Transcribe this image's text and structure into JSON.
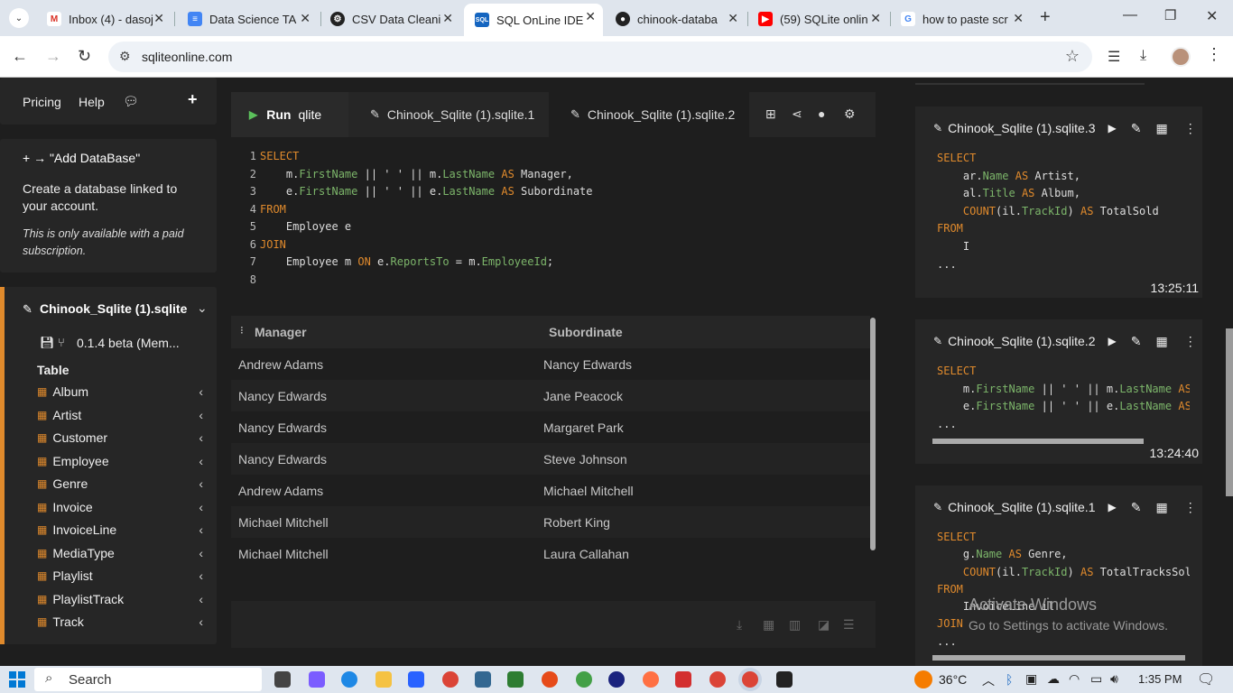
{
  "browser": {
    "tabs": [
      {
        "title": "Inbox (4) - dasoj",
        "icon": "gmail-icon",
        "color": "#d93025"
      },
      {
        "title": "Data Science TA",
        "icon": "docs-icon",
        "color": "#4285f4"
      },
      {
        "title": "CSV Data Cleani",
        "icon": "chatgpt-icon",
        "color": "#222222"
      },
      {
        "title": "SQL OnLine IDE",
        "icon": "sqlonline-icon",
        "color": "#1565c0",
        "active": true
      },
      {
        "title": "chinook-databa",
        "icon": "github-icon",
        "color": "#222222"
      },
      {
        "title": "(59) SQLite onlin",
        "icon": "youtube-icon",
        "color": "#ff0000"
      },
      {
        "title": "how to paste scr",
        "icon": "google-icon",
        "color": "#4285f4"
      }
    ],
    "url": "sqliteonline.com"
  },
  "sidebar": {
    "nav": {
      "pricing": "Pricing",
      "help": "Help"
    },
    "add_db": {
      "title": "+ → \"Add DataBase\"",
      "desc": "Create a database linked to your account.",
      "note": "This is only available with a paid subscription."
    },
    "db": {
      "name": "Chinook_Sqlite (1).sqlite",
      "version": "0.1.4 beta (Mem...",
      "table_header": "Table",
      "tables": [
        "Album",
        "Artist",
        "Customer",
        "Employee",
        "Genre",
        "Invoice",
        "InvoiceLine",
        "MediaType",
        "Playlist",
        "PlaylistTrack",
        "Track"
      ]
    }
  },
  "editor_tabs": {
    "run": "Run",
    "engine": "qlite",
    "tab1": "Chinook_Sqlite (1).sqlite.1",
    "tab2": "Chinook_Sqlite (1).sqlite.2"
  },
  "editor": {
    "line_numbers": [
      "1",
      "2",
      "3",
      "4",
      "5",
      "6",
      "7",
      "8"
    ]
  },
  "results": {
    "columns": [
      "Manager",
      "Subordinate"
    ],
    "rows": [
      [
        "Andrew Adams",
        "Nancy Edwards"
      ],
      [
        "Nancy Edwards",
        "Jane Peacock"
      ],
      [
        "Nancy Edwards",
        "Margaret Park"
      ],
      [
        "Nancy Edwards",
        "Steve Johnson"
      ],
      [
        "Andrew Adams",
        "Michael Mitchell"
      ],
      [
        "Michael Mitchell",
        "Robert King"
      ],
      [
        "Michael Mitchell",
        "Laura Callahan"
      ]
    ]
  },
  "history": [
    {
      "title": "Chinook_Sqlite (1).sqlite.3",
      "time": "13:25:11"
    },
    {
      "title": "Chinook_Sqlite (1).sqlite.2",
      "time": "13:24:40"
    },
    {
      "title": "Chinook_Sqlite (1).sqlite.1"
    }
  ],
  "watermark": {
    "line1": "Activate Windows",
    "line2": "Go to Settings to activate Windows."
  },
  "taskbar": {
    "search": "Search",
    "temp": "36°C",
    "time": "1:35 PM"
  },
  "colors": {
    "accent": "#e08a2c",
    "field": "#7cb56a",
    "panel": "#262626",
    "bg": "#1e1e1e"
  }
}
